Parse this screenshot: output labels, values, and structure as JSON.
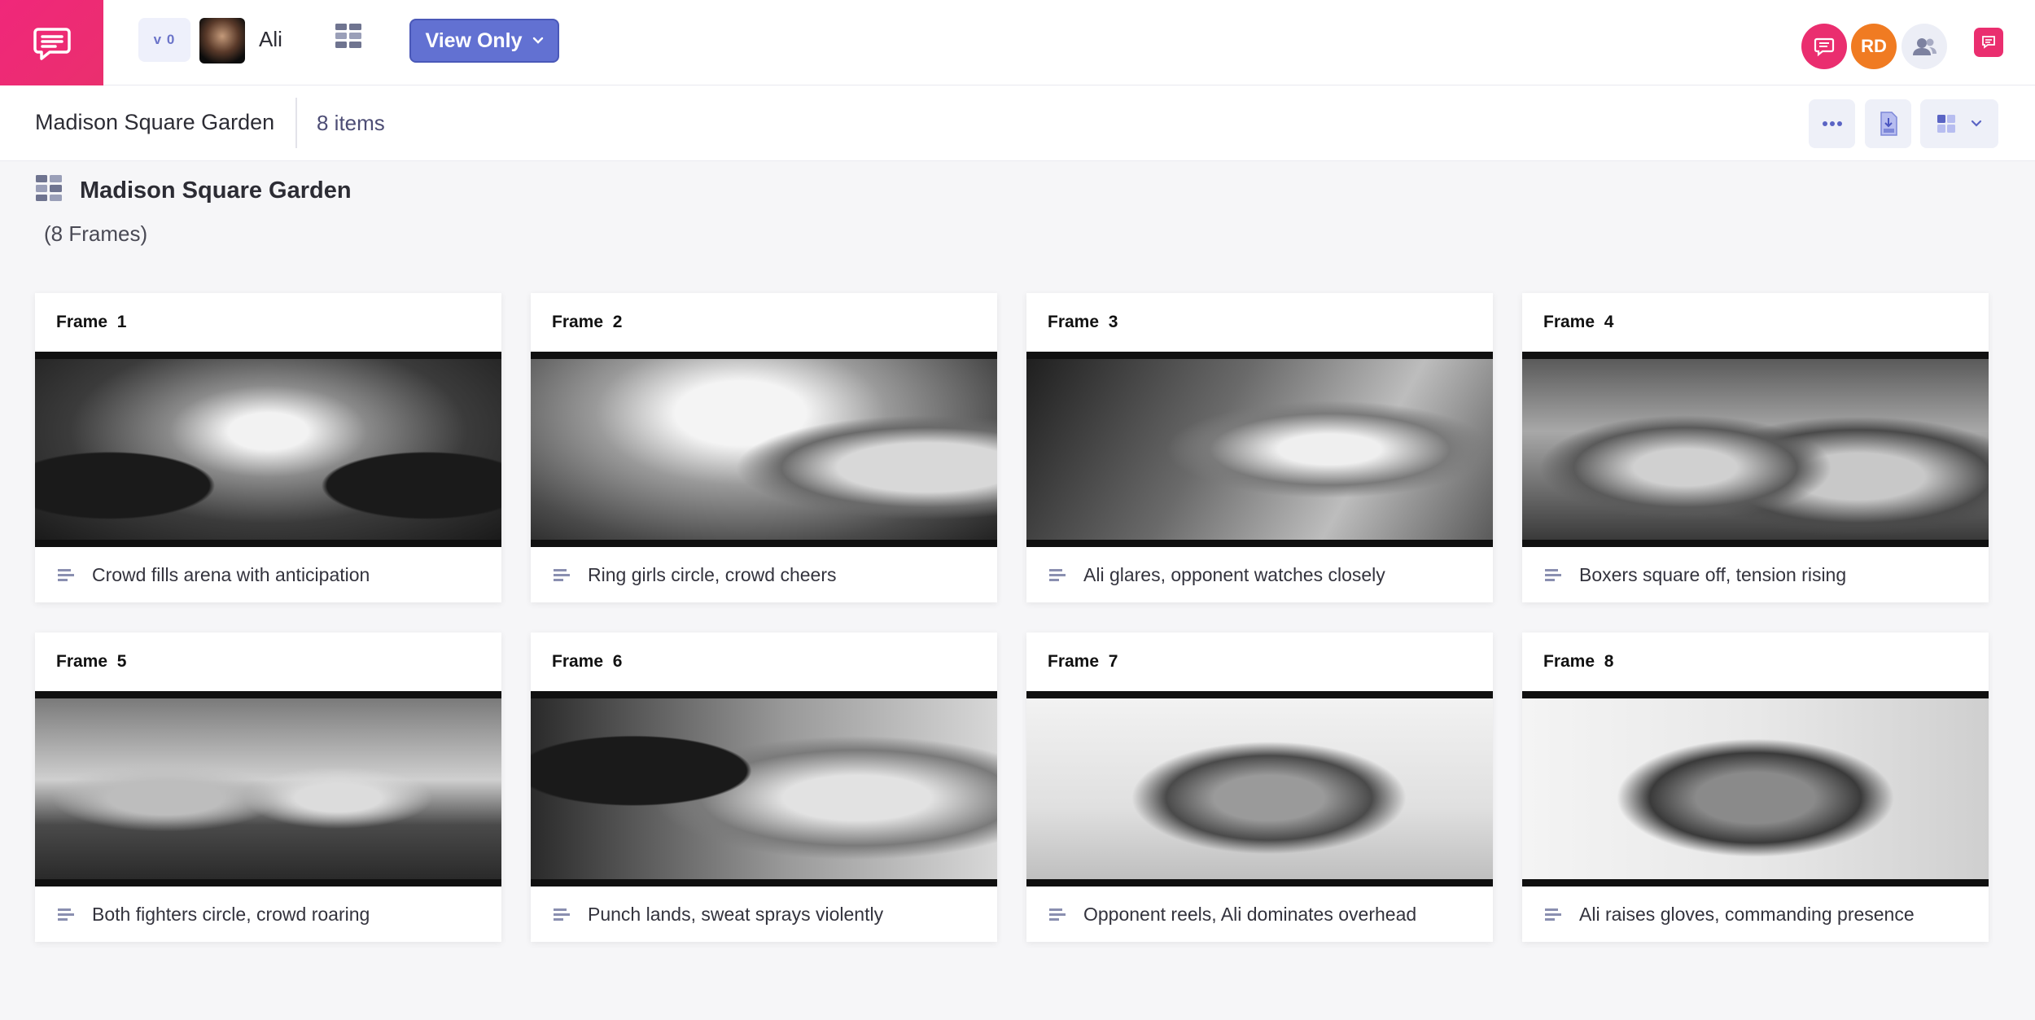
{
  "topbar": {
    "version_label": "v 0",
    "project_name": "Ali",
    "view_mode_label": "View Only",
    "avatar_initials": "RD",
    "colors": {
      "brand": "#ea2e6f",
      "accent": "#6271d2",
      "avatar_orange": "#f07b22"
    },
    "icons": [
      "chat-bubble-icon",
      "board-grid-icon",
      "chevron-down-icon",
      "users-icon",
      "notification-icon"
    ]
  },
  "subbar": {
    "title": "Madison Square Garden",
    "item_count": "8 items",
    "icons": [
      "more-dots-icon",
      "pdf-download-icon",
      "layout-grid-icon",
      "chevron-down-icon"
    ]
  },
  "section": {
    "title": "Madison Square Garden",
    "frame_count": "(8 Frames)"
  },
  "frames": [
    {
      "label": "Frame  1",
      "description": "Crowd fills arena with anticipation"
    },
    {
      "label": "Frame  2",
      "description": "Ring girls circle, crowd cheers"
    },
    {
      "label": "Frame  3",
      "description": "Ali glares, opponent watches closely"
    },
    {
      "label": "Frame  4",
      "description": "Boxers square off, tension rising"
    },
    {
      "label": "Frame  5",
      "description": "Both fighters circle, crowd roaring"
    },
    {
      "label": "Frame  6",
      "description": "Punch lands, sweat sprays violently"
    },
    {
      "label": "Frame  7",
      "description": "Opponent reels, Ali dominates overhead"
    },
    {
      "label": "Frame  8",
      "description": "Ali raises gloves, commanding presence"
    }
  ]
}
